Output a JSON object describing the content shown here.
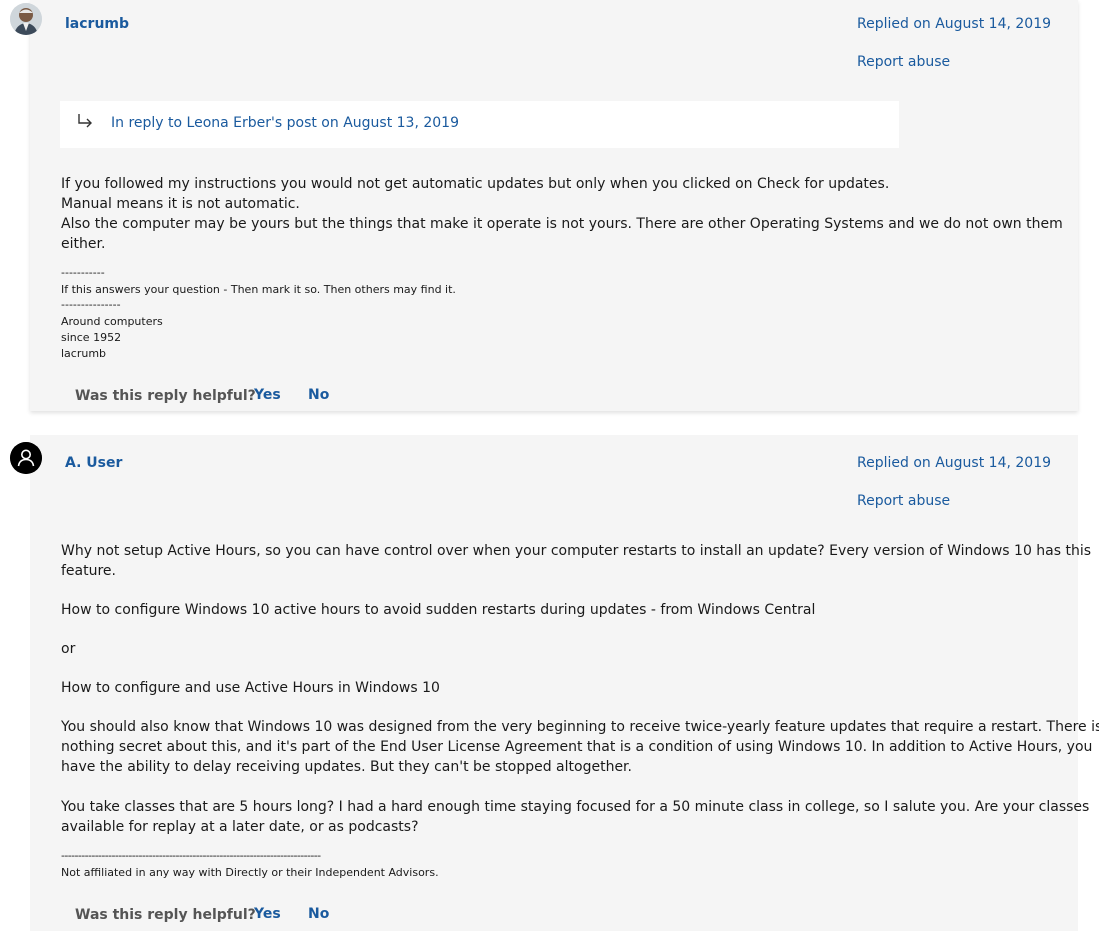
{
  "replies": [
    {
      "author": "lacrumb",
      "date": "Replied on August 14, 2019",
      "report": "Report abuse",
      "in_reply_to": "In reply to Leona Erber's post on August 13, 2019",
      "body": [
        "If you followed my instructions you would not get automatic updates but only when you clicked on Check for updates.",
        "Manual means it is not automatic.",
        "Also the computer may be yours but the things that make it operate is not yours.  There are other Operating Systems and we do not own them",
        "either."
      ],
      "signature": [
        "-----------",
        "If this answers your question - Then mark it so.  Then others may find it.",
        "---------------",
        "Around computers",
        "since 1952",
        "lacrumb"
      ],
      "helpful": "Was this reply helpful?",
      "yes": "Yes",
      "no": "No"
    },
    {
      "author": "A. User",
      "date": "Replied on August 14, 2019",
      "report": "Report abuse",
      "p1": [
        "Why not setup Active Hours, so you can have control over when your computer restarts to install an update? Every version of Windows 10 has this",
        "feature."
      ],
      "link1": "How to configure Windows 10 active hours to avoid sudden restarts during updates - from Windows Central",
      "or": "or",
      "link2": "How to configure and use Active Hours in Windows 10",
      "p2": [
        "You should also know that Windows 10 was designed from the very beginning to receive twice-yearly feature updates that require a restart. There is",
        "nothing secret about this, and it's part of the End User License Agreement that is a condition of using Windows 10. In addition to Active Hours, you",
        "have the ability to delay receiving updates. But they can't be stopped altogether."
      ],
      "p3": [
        "You take classes that are 5 hours long? I had a hard enough time staying focused for a 50 minute class in college, so I salute you. Are your classes",
        "available for replay at a later date, or as podcasts?"
      ],
      "signature": [
        "-----------------------------------------------------------------------------",
        "Not affiliated in any way with Directly or their Independent Advisors."
      ],
      "helpful": "Was this reply helpful?",
      "yes": "Yes",
      "no": "No"
    }
  ],
  "colors": {
    "link": "#1a5a9e",
    "card": "#f5f5f5"
  },
  "icons": {
    "reply_arrow": "reply-arrow-icon",
    "user_avatar": "user-avatar-icon"
  }
}
